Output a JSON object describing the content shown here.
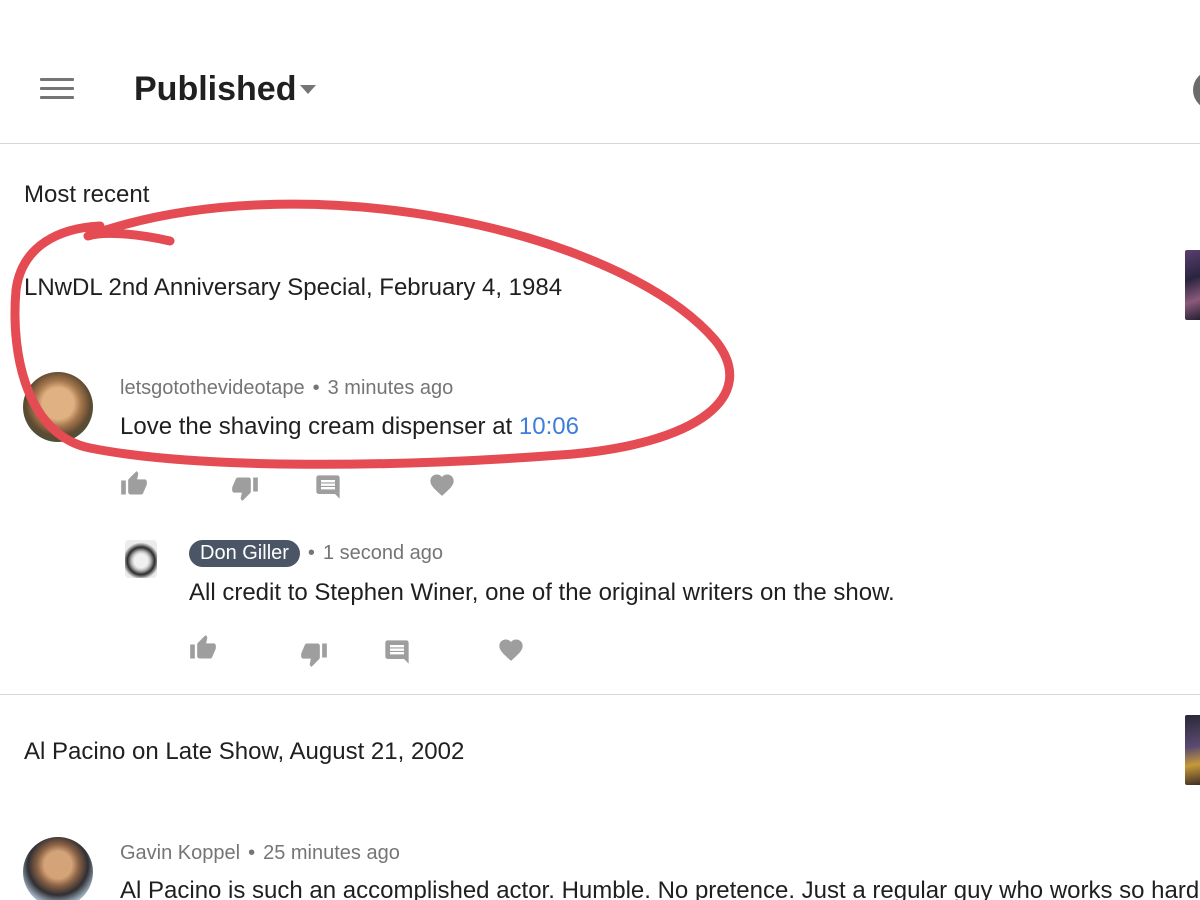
{
  "header": {
    "title": "Published"
  },
  "section": {
    "label": "Most recent"
  },
  "videos": [
    {
      "title": "LNwDL 2nd Anniversary Special, February 4, 1984",
      "comment": {
        "author": "letsgotothevideotape",
        "time": "3 minutes ago",
        "text": "Love the shaving cream dispenser at ",
        "timestamp_link": "10:06"
      },
      "reply": {
        "author": "Don Giller",
        "time": "1 second ago",
        "text": "All credit to Stephen Winer, one of the original writers on the show."
      }
    },
    {
      "title": "Al Pacino on Late Show, August 21, 2002",
      "comment": {
        "author": "Gavin Koppel",
        "time": "25 minutes ago",
        "text": "Al Pacino is such an accomplished actor. Humble. No pretence. Just a regular guy who works so hard"
      }
    }
  ],
  "icons": {
    "menu": "hamburger-menu-icon",
    "dropdown": "caret-down-icon",
    "like": "thumbs-up-icon",
    "dislike": "thumbs-down-icon",
    "reply": "reply-comment-icon",
    "heart": "heart-icon"
  },
  "colors": {
    "link": "#3d7ddb",
    "owner_badge": "#4a5566",
    "annotation_ink": "#e54b53",
    "icon_gray": "#9e9e9e"
  }
}
